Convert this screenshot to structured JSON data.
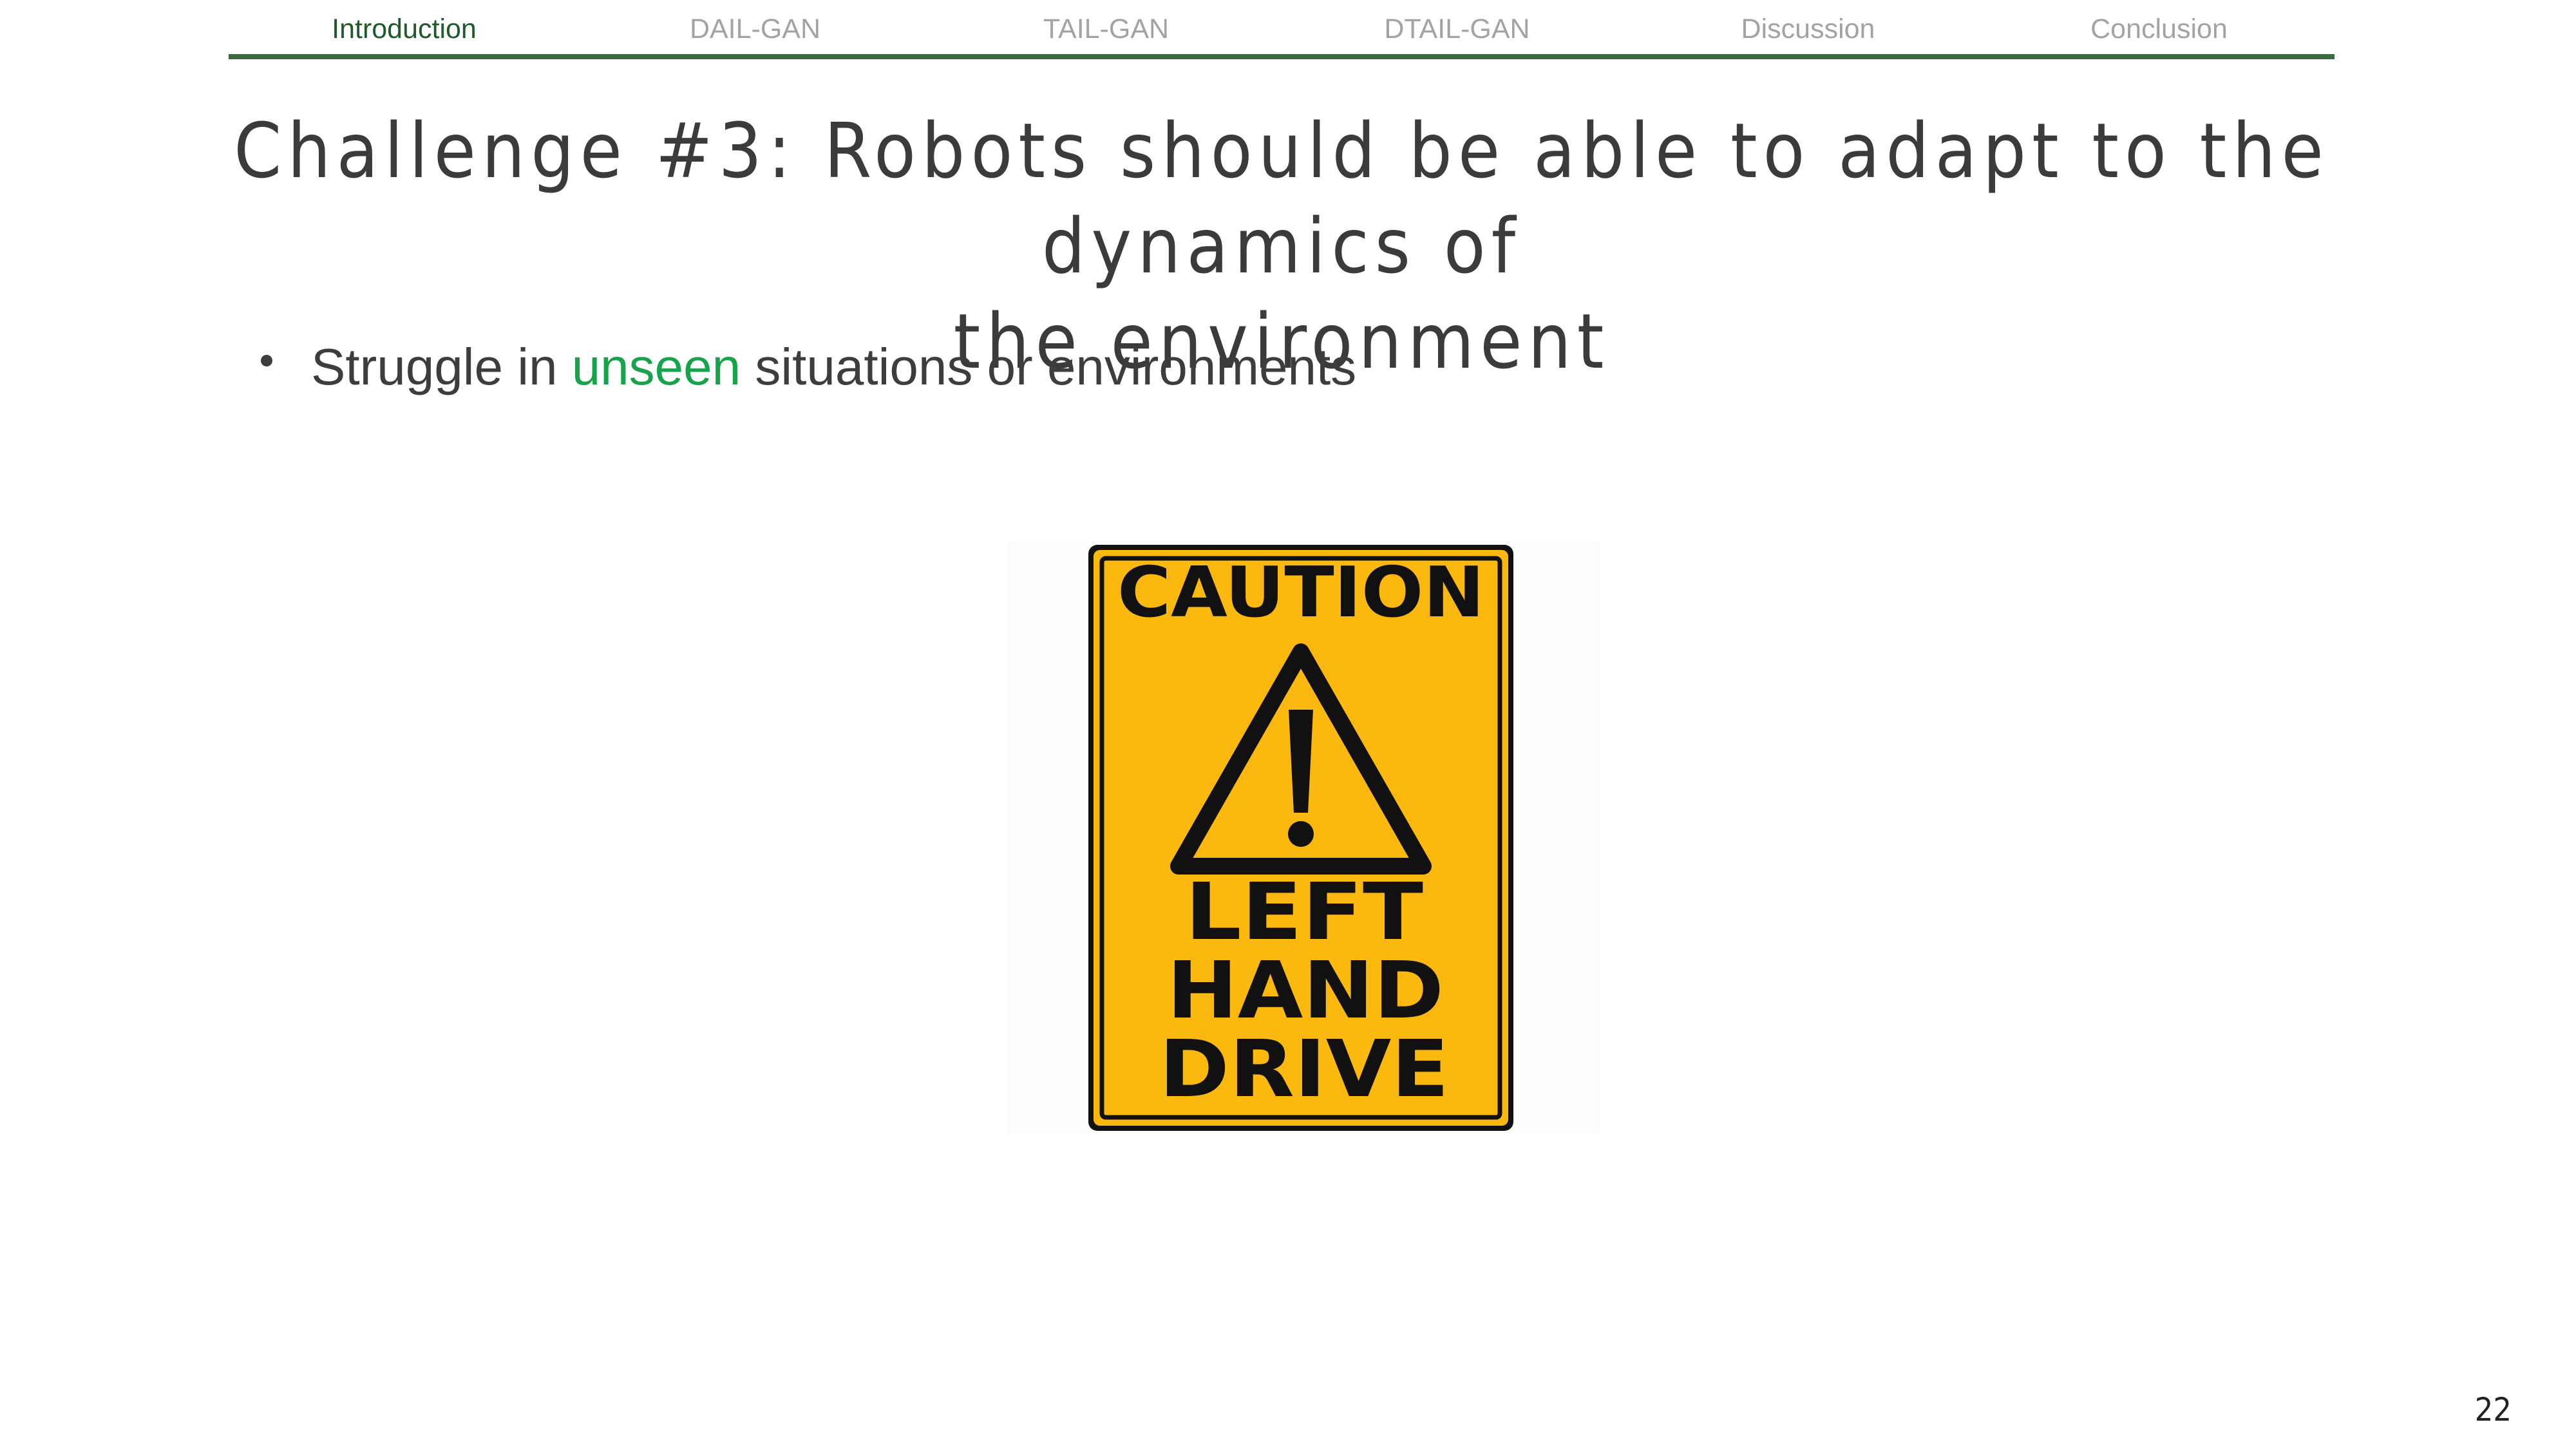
{
  "nav": {
    "items": [
      {
        "label": "Introduction",
        "active": true
      },
      {
        "label": "DAIL-GAN",
        "active": false
      },
      {
        "label": "TAIL-GAN",
        "active": false
      },
      {
        "label": "DTAIL-GAN",
        "active": false
      },
      {
        "label": "Discussion",
        "active": false
      },
      {
        "label": "Conclusion",
        "active": false
      }
    ]
  },
  "title": {
    "line1": "Challenge #3: Robots should be able to adapt to the dynamics of",
    "line2": "the environment"
  },
  "bullet": {
    "before": "Struggle in ",
    "highlight": "unseen",
    "after": " situations or environments"
  },
  "sign": {
    "heading": "CAUTION",
    "line1": "LEFT",
    "line2": "HAND",
    "line3": "DRIVE",
    "icon": "warning-triangle-exclamation"
  },
  "colors": {
    "accent": "#16a34a",
    "nav_active": "#1f5a2b",
    "nav_inactive": "#a3a3a3",
    "rule": "#3d6b40",
    "sign_yellow": "#fbb90f"
  },
  "page_number": "22"
}
